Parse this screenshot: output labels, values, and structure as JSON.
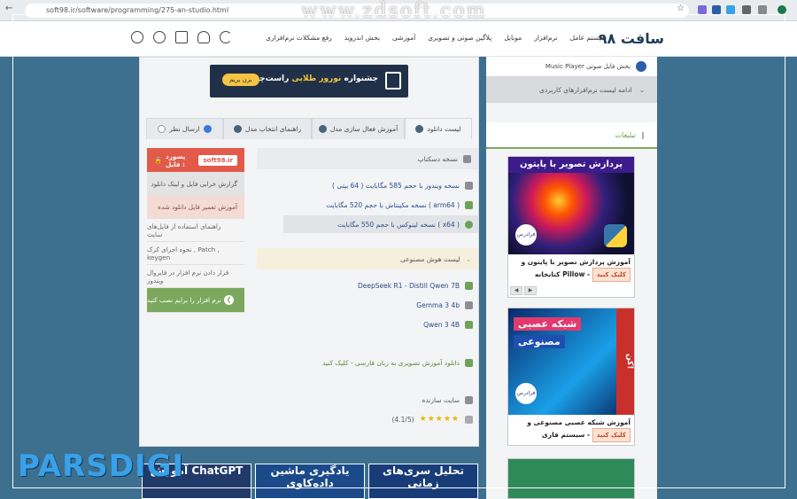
{
  "browser": {
    "url": "soft98.ir/software/programming/275-an-studio.html",
    "watermark": "www.zdsoft.com"
  },
  "header": {
    "logo": "سافت ۹۸",
    "nav": [
      "سیستم عامل",
      "نرم‌افزار",
      "موبایل",
      "پلاگین صوتی و تصویری",
      "آموزشی",
      "بخش اندروید",
      "رفع مشکلات نرم‌افزاری"
    ]
  },
  "banner": {
    "text_a": "جشنواره ",
    "text_highlight": "نوروز طلایی",
    "text_b": " راست‌چین",
    "button": "بزن بریم"
  },
  "tabs": {
    "download_list": "لیست دانلود",
    "activation": "آموزش فعال سازی مدل",
    "model_guide": "راهنمای انتخاب مدل",
    "comment": "ارسال نظر"
  },
  "left_box": {
    "password_label": "پسورد فایل :",
    "password_value": "soft98.ir",
    "report_broken": "گزارش خرابی فایل و لینک دانلود",
    "fix_corrupt": "آموزش تعمیر فایل دانلود شده",
    "site_guide": "راهنمای استفاده از فایل‌های سایت",
    "crack_help": "نحوه اجرای کرک , Patch , keygen",
    "firewall": "قرار دادن نرم افزار در فایروال ویندوز",
    "install_button": "نرم افزار را برایم نصب کنید"
  },
  "downloads": {
    "desktop_header": "نسخه دسکتاپ",
    "windows": "نسخه ویندوز با حجم 585 مگابایت ( 64 بیتی )",
    "mac": "نسخه مکینتاش با حجم 520 مگابایت ( arm64 )",
    "linux": "نسخه لینوکس با حجم 550 مگابایت ( x64 )",
    "ai_header": "لیست هوش مصنوعی",
    "ai_models": [
      "DeepSeek R1 - Distill Qwen 7B",
      "Gemma 3 4b",
      "Qwen 3 4B"
    ],
    "video_tutorial": "دانلود آموزش تصویری به زبان فارسی - کلیک کنید",
    "vendor_site": "سایت سازنده",
    "rating": "(4.1/5)"
  },
  "sidebar": {
    "music_player": "Music Player بخش فایل صوتی",
    "more_apps": "ادامه لیست نرم‌افزارهای کاربردی",
    "ads_title": "تبلیغات",
    "ad1_banner": "پردازش تصویر با پایتون",
    "ad1_caption": "آموزش پردازش تصویر با پایتون و کتابخانه Pillow",
    "ad1_click": "کلیک کنید",
    "ad2_top": "شبکه عصبی",
    "ad2_bottom": "مصنوعی",
    "ad2_side": "کن!",
    "ad2_caption": "آموزش شبکه عصبی مصنوعی و سیستم فازی",
    "ad2_click": "کلیک کنید",
    "faradars": "فرادرس"
  },
  "bottom_thumbs": [
    "آموزش ChatGPT",
    "یادگیری ماشین داده‌کاوی",
    "تحلیل سری‌های زمانی"
  ],
  "brand": "PARSDIGI",
  "colors": {
    "accent_red": "#e25a4a",
    "accent_green": "#7ba85c",
    "page_bg": "#3d6f8f"
  }
}
